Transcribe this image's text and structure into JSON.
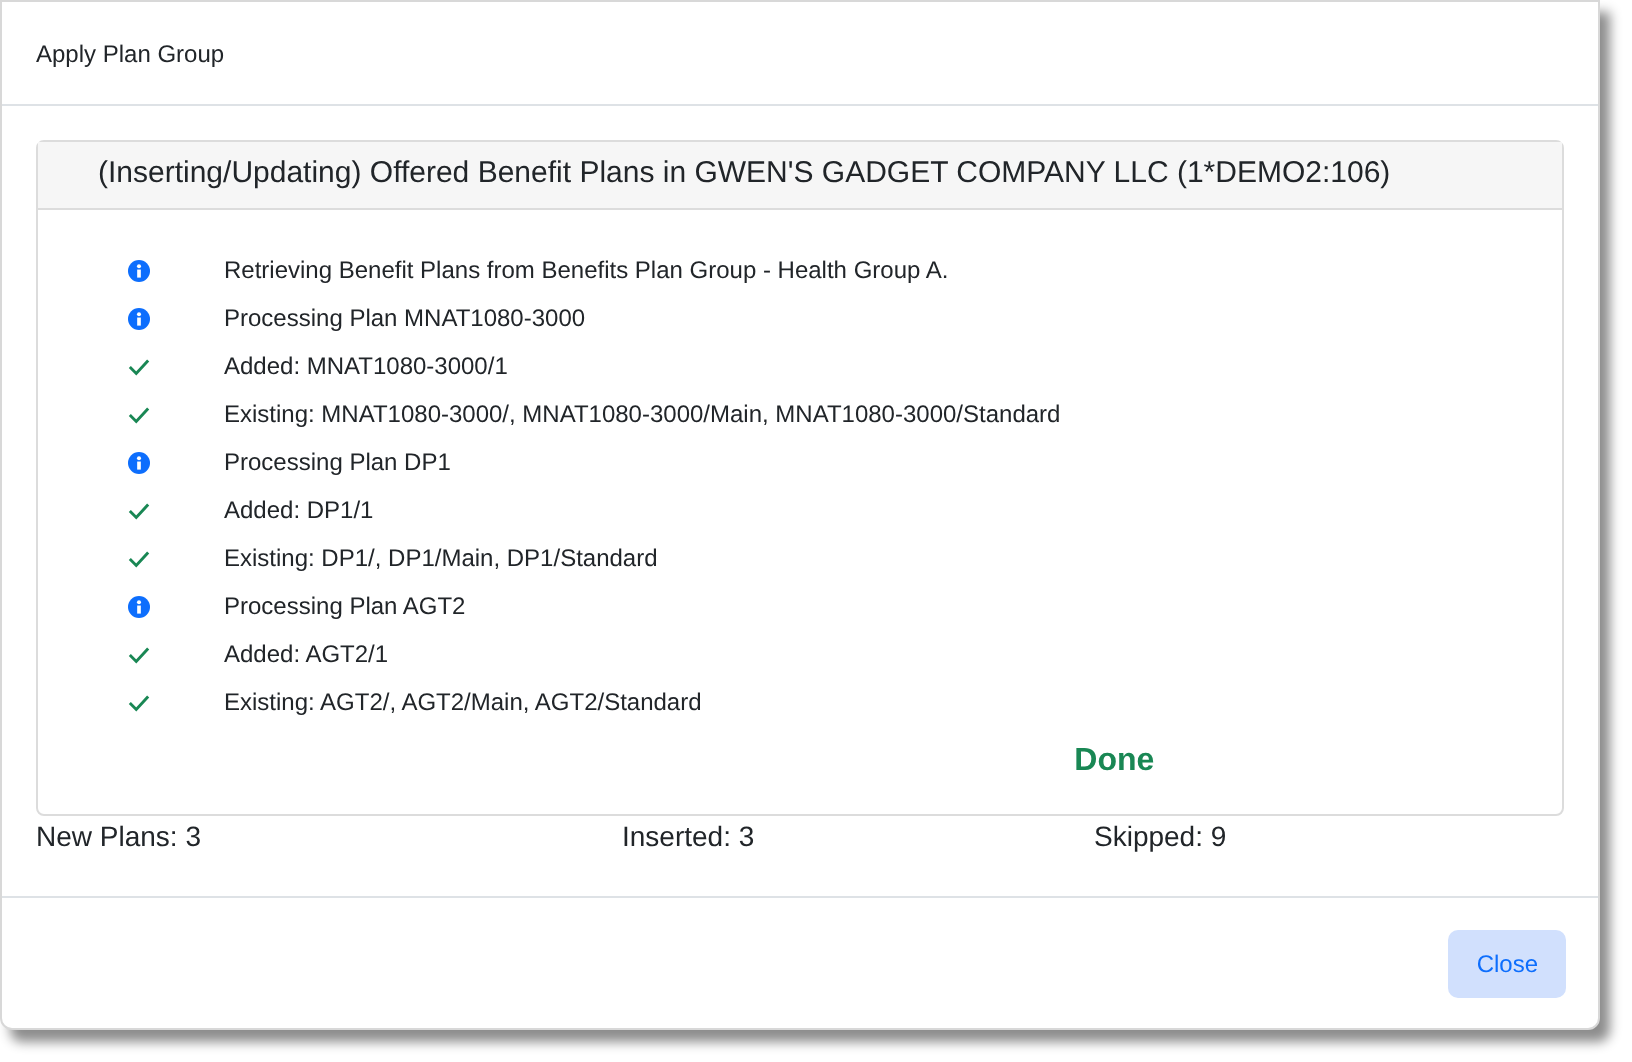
{
  "dialog": {
    "title": "Apply Plan Group"
  },
  "panel": {
    "title": "(Inserting/Updating) Offered Benefit Plans in GWEN'S GADGET COMPANY LLC (1*DEMO2:106)",
    "log": [
      {
        "kind": "info",
        "text": "Retrieving Benefit Plans from Benefits Plan Group - Health Group A."
      },
      {
        "kind": "info",
        "text": "Processing Plan MNAT1080-3000"
      },
      {
        "kind": "success",
        "text": "Added: MNAT1080-3000/1"
      },
      {
        "kind": "success",
        "text": "Existing: MNAT1080-3000/, MNAT1080-3000/Main, MNAT1080-3000/Standard"
      },
      {
        "kind": "info",
        "text": "Processing Plan DP1"
      },
      {
        "kind": "success",
        "text": "Added: DP1/1"
      },
      {
        "kind": "success",
        "text": "Existing: DP1/, DP1/Main, DP1/Standard"
      },
      {
        "kind": "info",
        "text": "Processing Plan AGT2"
      },
      {
        "kind": "success",
        "text": "Added: AGT2/1"
      },
      {
        "kind": "success",
        "text": "Existing: AGT2/, AGT2/Main, AGT2/Standard"
      }
    ],
    "status": "Done"
  },
  "stats": [
    "New Plans: 3",
    "Inserted: 3",
    "Skipped: 9"
  ],
  "buttons": [
    "Close"
  ]
}
